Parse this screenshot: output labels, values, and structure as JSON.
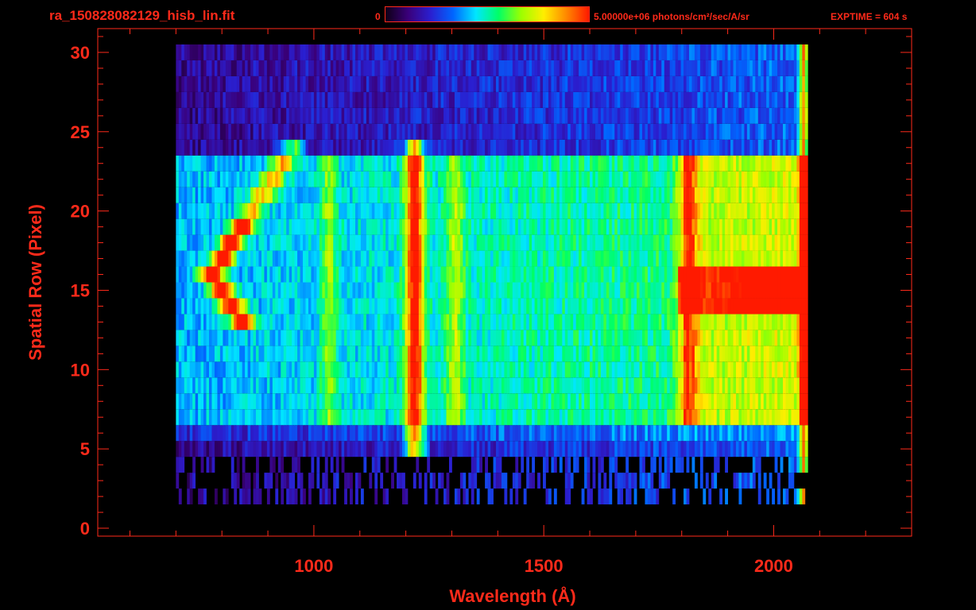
{
  "header": {
    "filename": "ra_150828082129_hisb_lin.fit",
    "colorbar_min": "0",
    "colorbar_max": "5.00000e+06 photons/cm²/sec/A/sr",
    "exptime": "EXPTIME = 604 s"
  },
  "colors": {
    "axis": "#ff2a1a",
    "background": "#000000",
    "colormap": [
      "#0d0015",
      "#3a007a",
      "#2a1fd0",
      "#0066ff",
      "#00e6ff",
      "#00ff66",
      "#9cff00",
      "#ffee00",
      "#ff8800",
      "#ff1a00"
    ]
  },
  "chart_data": {
    "type": "heatmap",
    "title": "ra_150828082129_hisb_lin.fit",
    "xlabel": "Wavelength (Å)",
    "ylabel": "Spatial Row (Pixel)",
    "xlim": [
      530,
      2300
    ],
    "ylim": [
      -0.5,
      31.5
    ],
    "xticks": [
      1000,
      1500,
      2000
    ],
    "yticks": [
      0,
      5,
      10,
      15,
      20,
      25,
      30
    ],
    "colorbar_range": [
      0,
      5000000
    ],
    "colorbar_unit": "photons/cm²/sec/A/sr",
    "row_range": [
      2,
      30
    ],
    "wavelength_range": [
      700,
      2070
    ],
    "features": [
      {
        "wavelength": 775,
        "rows": [
          13,
          19
        ],
        "intensity": 0.95
      },
      {
        "wavelength": 1216,
        "rows": [
          5,
          24
        ],
        "intensity": 0.9
      },
      {
        "wavelength": 1030,
        "rows": [
          7,
          23
        ],
        "intensity": 0.45
      },
      {
        "wavelength": 1304,
        "rows": [
          6,
          23
        ],
        "intensity": 0.45
      },
      {
        "wavelength": 1810,
        "rows": [
          6,
          23
        ],
        "intensity": 0.6
      },
      {
        "wavelength": 2060,
        "rows": [
          2,
          30
        ],
        "intensity": 0.85
      },
      {
        "wavelength_range": [
          1800,
          2060
        ],
        "rows": [
          14,
          16
        ],
        "intensity": 0.8
      }
    ]
  }
}
